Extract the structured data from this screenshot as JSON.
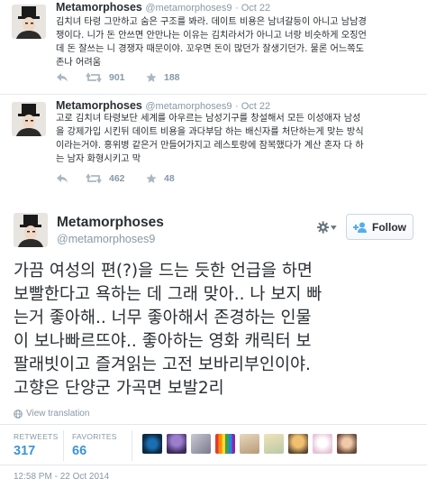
{
  "tweets": [
    {
      "name": "Metamorphoses",
      "handle": "@metamorphoses9",
      "date": "Oct 22",
      "lines": [
        "김치녀 타령 그만하고 숨은 구조를 봐라. 데이트 비용은 남녀갈등이 아니고 남남경",
        "쟁이다. 니가 돈 안쓰면 안만나는 이유는 김치라서가 아니고 너랑 비슷하게 오징언",
        "데 돈 잘쓰는 니 경쟁자 때문이야. 꼬우면 돈이 많던가 잘생기던가. 물론 어느쪽도",
        "존나 어려움"
      ],
      "retweets": "901",
      "favorites": "188"
    },
    {
      "name": "Metamorphoses",
      "handle": "@metamorphoses9",
      "date": "Oct 22",
      "lines": [
        "고로 김치녀 타령보단 세계를 아우르는 남성기구를 창설해서 모든 이성애자 남성",
        "을 강제가입 시킨뒤 데이트 비용을 과다부담 하는 배신자를 처단하는게 맞는 방식",
        "이라는거야. 홍위병 같은거 만들어가지고 레스토랑에 잠복했다가 계산 혼자 다 하",
        "는 남자 화형시키고 막"
      ],
      "retweets": "462",
      "favorites": "48"
    }
  ],
  "main_tweet": {
    "name": "Metamorphoses",
    "handle": "@metamorphoses9",
    "follow_label": "Follow",
    "lines": [
      "가끔 여성의 편(?)을 드는 듯한 언급을 하면",
      "보빨한다고 욕하는 데 그래 맞아.. 나 보지 빠",
      "는거 좋아해.. 너무 좋아해서 존경하는 인물",
      "이 보나빠르뜨야.. 좋아하는 영화 캐릭터 보",
      "팔래빗이고 즐겨읽는 고전 보바리부인이야.",
      "고향은 단양군 가곡면 보발2리"
    ],
    "view_translation": "View translation",
    "retweets_label": "RETWEETS",
    "retweets": "317",
    "favorites_label": "FAVORITES",
    "favorites": "66",
    "timestamp": "12:58 PM - 22 Oct 2014"
  },
  "icons": {
    "avatar": "person-in-top-hat-avatar",
    "reply": "reply-arrow-icon",
    "retweet": "retweet-icon",
    "favorite": "star-icon",
    "settings": "gear-icon",
    "follow": "add-user-icon",
    "translate": "globe-icon"
  },
  "colors": {
    "link_blue": "#3b94d9",
    "muted": "#8899a6",
    "text": "#292f33",
    "border": "#e1e8ed"
  }
}
